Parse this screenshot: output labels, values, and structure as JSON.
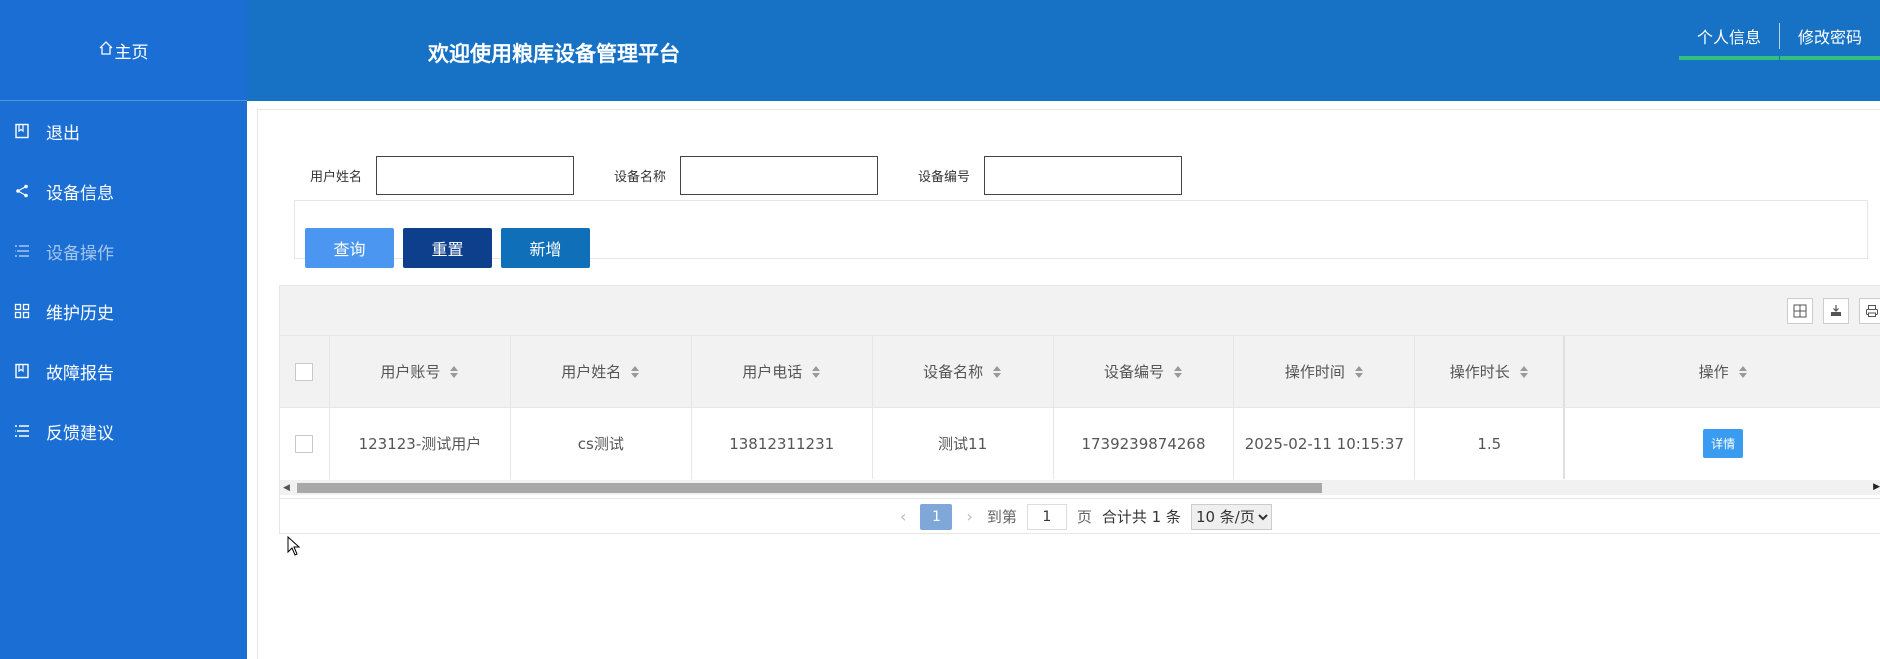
{
  "sidebar": {
    "home_label": "主页",
    "items": [
      {
        "label": "退出",
        "icon": "book-icon"
      },
      {
        "label": "设备信息",
        "icon": "share-icon"
      },
      {
        "label": "设备操作",
        "icon": "list-icon",
        "active": true
      },
      {
        "label": "维护历史",
        "icon": "grid-icon"
      },
      {
        "label": "故障报告",
        "icon": "book-icon"
      },
      {
        "label": "反馈建议",
        "icon": "list-icon"
      }
    ]
  },
  "header": {
    "title": "欢迎使用粮库设备管理平台",
    "profile_link": "个人信息",
    "password_link": "修改密码"
  },
  "search": {
    "username_label": "用户姓名",
    "device_name_label": "设备名称",
    "device_no_label": "设备编号",
    "query_btn": "查询",
    "reset_btn": "重置",
    "add_btn": "新增"
  },
  "table": {
    "columns": [
      "用户账号",
      "用户姓名",
      "用户电话",
      "设备名称",
      "设备编号",
      "操作时间",
      "操作时长",
      "操作"
    ],
    "rows": [
      {
        "account": "123123-测试用户",
        "name": "cs测试",
        "phone": "13812311231",
        "device_name": "测试11",
        "device_no": "1739239874268",
        "op_time": "2025-02-11 10:15:37",
        "duration": "1.5",
        "action": "详情"
      }
    ]
  },
  "pager": {
    "current": "1",
    "goto_label": "到第",
    "goto_value": "1",
    "page_unit": "页",
    "total": "合计共 1 条",
    "page_size": "10 条/页"
  },
  "colors": {
    "sidebar": "#1b6fd4",
    "header": "#1772c6",
    "accent_green": "#2fbf7f",
    "query": "#4a96f0",
    "reset": "#0d3f8d",
    "add": "#0f6fb8"
  }
}
